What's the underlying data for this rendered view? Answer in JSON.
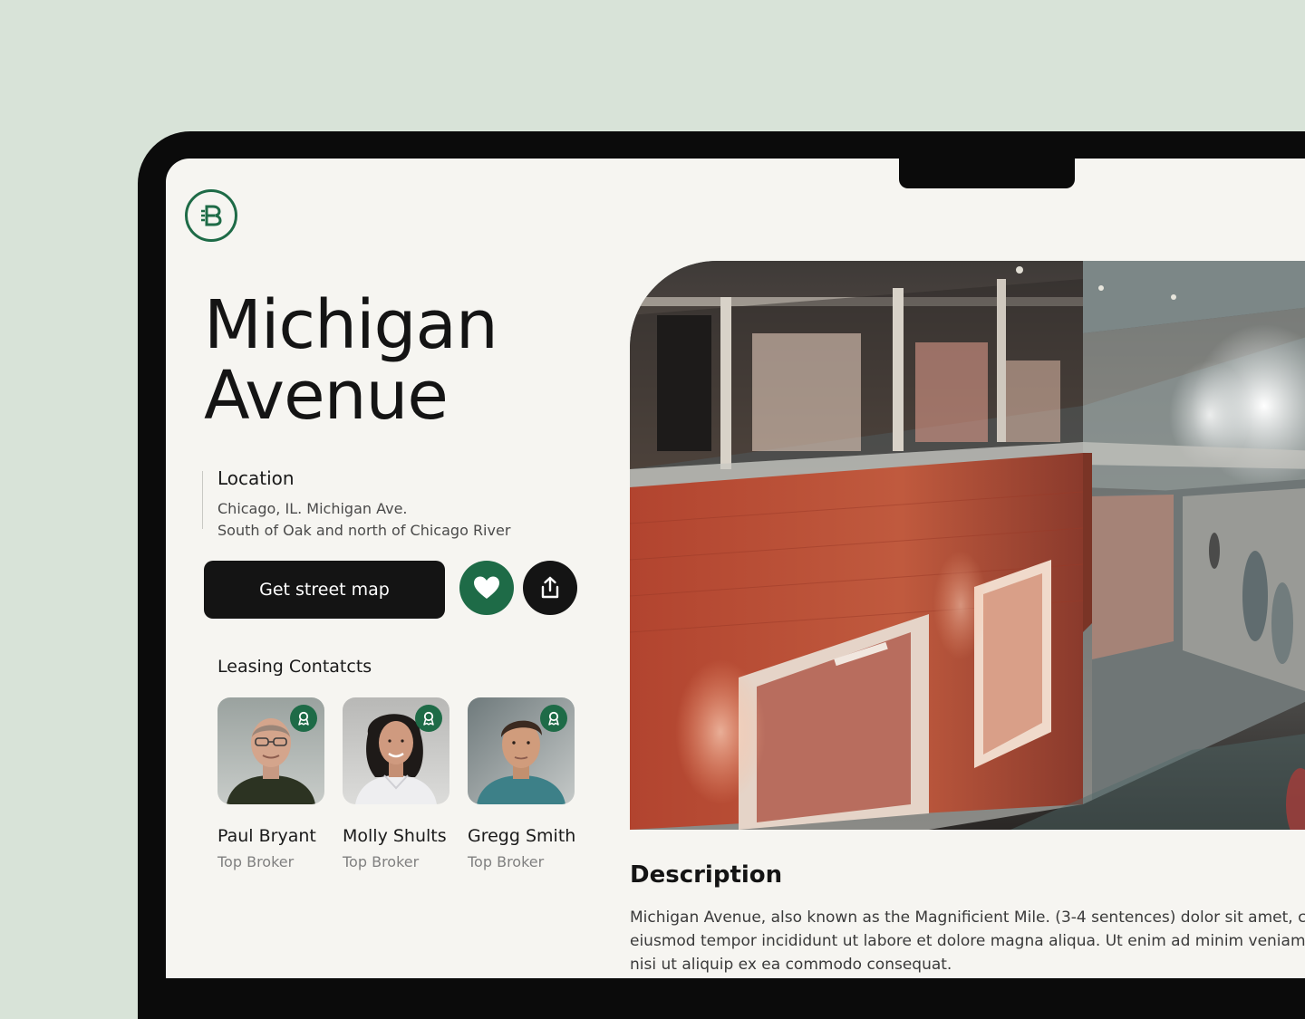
{
  "property": {
    "title": "Michigan Avenue",
    "title_line1": "Michigan",
    "title_line2": "Avenue"
  },
  "location": {
    "label": "Location",
    "line1": "Chicago, IL. Michigan Ave.",
    "line2": "South of Oak and north of Chicago River"
  },
  "actions": {
    "street_map_label": "Get street map",
    "favorite_icon": "heart-icon",
    "share_icon": "share-icon"
  },
  "contacts": {
    "title": "Leasing Contatcts",
    "items": [
      {
        "name": "Paul Bryant",
        "role": "Top Broker"
      },
      {
        "name": "Molly Shults",
        "role": "Top Broker"
      },
      {
        "name": "Gregg Smith",
        "role": "Top Broker"
      }
    ]
  },
  "description": {
    "title": "Description",
    "line1": "Michigan Avenue, also known as the Magnificient Mile.  (3-4 sentences) dolor sit amet, consectetur adipiscing elit, sed do",
    "line2": "eiusmod tempor incididunt ut labore et dolore magna aliqua. Ut enim ad minim veniam, quis nostrud exercitation ullamco laboris",
    "line3": "nisi ut aliquip ex ea commodo consequat."
  },
  "colors": {
    "background": "#d8e3d8",
    "brand_green": "#1e6b47",
    "dark": "#141414",
    "screen": "#f6f5f1"
  }
}
